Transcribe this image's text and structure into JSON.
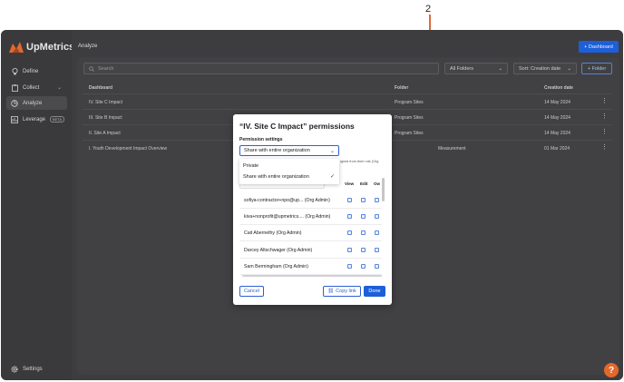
{
  "callout": {
    "number": "2"
  },
  "app": {
    "brand": "UpMetrics"
  },
  "sidebar": {
    "items": [
      {
        "label": "Define",
        "icon": "lightbulb-icon"
      },
      {
        "label": "Collect",
        "icon": "clipboard-icon",
        "chevron": "⌄"
      },
      {
        "label": "Analyze",
        "icon": "chart-icon",
        "active": true
      },
      {
        "label": "Leverage",
        "icon": "leverage-icon",
        "badge": "BETA"
      }
    ],
    "settings": "Settings"
  },
  "header": {
    "title": "Analyze",
    "dashboard_button": "+ Dashboard"
  },
  "toolbar": {
    "search_placeholder": "Search",
    "folder_filter": "All Folders",
    "sort_filter": "Sort: Creation date",
    "folder_button": "+ Folder"
  },
  "table": {
    "columns": [
      "Dashboard",
      "Folder",
      "Creation date"
    ],
    "rows": [
      {
        "name": "IV. Site C Impact",
        "folder": "Program Sites",
        "date": "14 May 2024"
      },
      {
        "name": "III. Site B Impact",
        "folder": "Program Sites",
        "date": "14 May 2024"
      },
      {
        "name": "II. Site A Impact",
        "folder": "Program Sites",
        "date": "14 May 2024"
      },
      {
        "name": "I. Youth Development Impact Overview",
        "folder": "Measurement",
        "date": "01 Mar 2024"
      }
    ]
  },
  "modal": {
    "title": "“IV. Site C Impact” permissions",
    "section_label": "Permission settings",
    "selected_option": "Share with entire organization",
    "options": [
      "Private",
      "Share with entire organization"
    ],
    "hidden_hint": "igned from their role (Org",
    "column_headers": [
      "View",
      "Edit",
      "Ow"
    ],
    "users": [
      "sofiya-contractor+npo@up...  (Org Admin)",
      "kiva+nonprofit@upmetrics....  (Org Admin)",
      "Cait Abernethy  (Org Admin)",
      "Darcey Altschwager  (Org Admin)",
      "Sam Bermingham  (Org Admin)"
    ],
    "cancel": "Cancel",
    "copy_link": "Copy link",
    "done": "Done"
  },
  "help_label": "?",
  "colors": {
    "accent": "#1d5fd8",
    "callout": "#e2673a",
    "brand": "#e4682b"
  }
}
